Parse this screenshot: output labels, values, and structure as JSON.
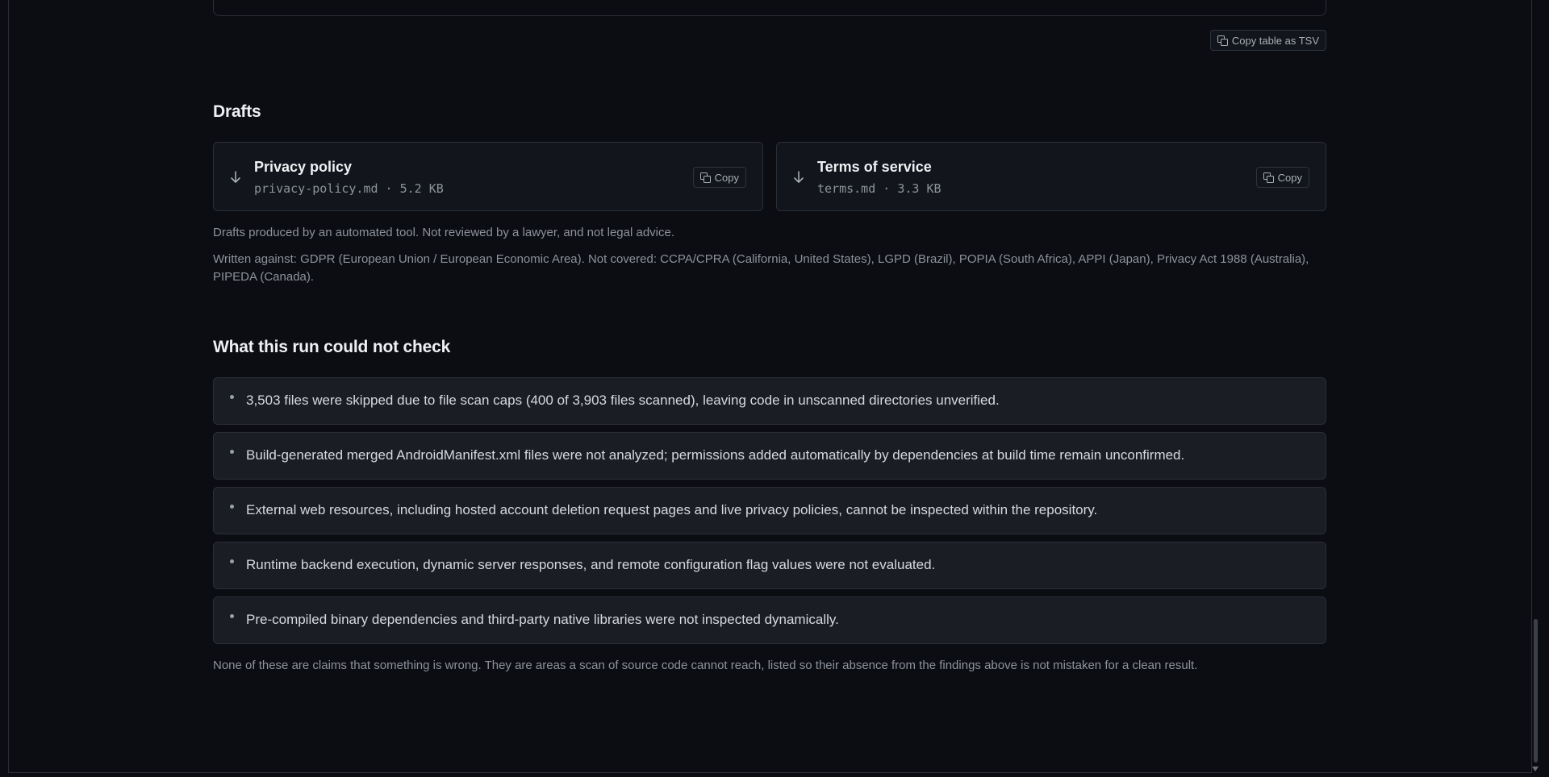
{
  "table_actions": {
    "copy_tsv_label": "Copy table as TSV"
  },
  "drafts": {
    "title": "Drafts",
    "items": [
      {
        "title": "Privacy policy",
        "meta": "privacy-policy.md · 5.2 KB",
        "copy_label": "Copy"
      },
      {
        "title": "Terms of service",
        "meta": "terms.md · 3.3 KB",
        "copy_label": "Copy"
      }
    ],
    "disclaimer": "Drafts produced by an automated tool. Not reviewed by a lawyer, and not legal advice.",
    "coverage": "Written against: GDPR (European Union / European Economic Area). Not covered: CCPA/CPRA (California, United States), LGPD (Brazil), POPIA (South Africa), APPI (Japan), Privacy Act 1988 (Australia), PIPEDA (Canada)."
  },
  "checks": {
    "title": "What this run could not check",
    "items": [
      "3,503 files were skipped due to file scan caps (400 of 3,903 files scanned), leaving code in unscanned directories unverified.",
      "Build-generated merged AndroidManifest.xml files were not analyzed; permissions added automatically by dependencies at build time remain unconfirmed.",
      "External web resources, including hosted account deletion request pages and live privacy policies, cannot be inspected within the repository.",
      "Runtime backend execution, dynamic server responses, and remote configuration flag values were not evaluated.",
      "Pre-compiled binary dependencies and third-party native libraries were not inspected dynamically."
    ],
    "footnote": "None of these are claims that something is wrong. They are areas a scan of source code cannot reach, listed so their absence from the findings above is not mistaken for a clean result."
  },
  "icons": {
    "download": "arrow-down-icon",
    "copy": "copy-icon"
  }
}
